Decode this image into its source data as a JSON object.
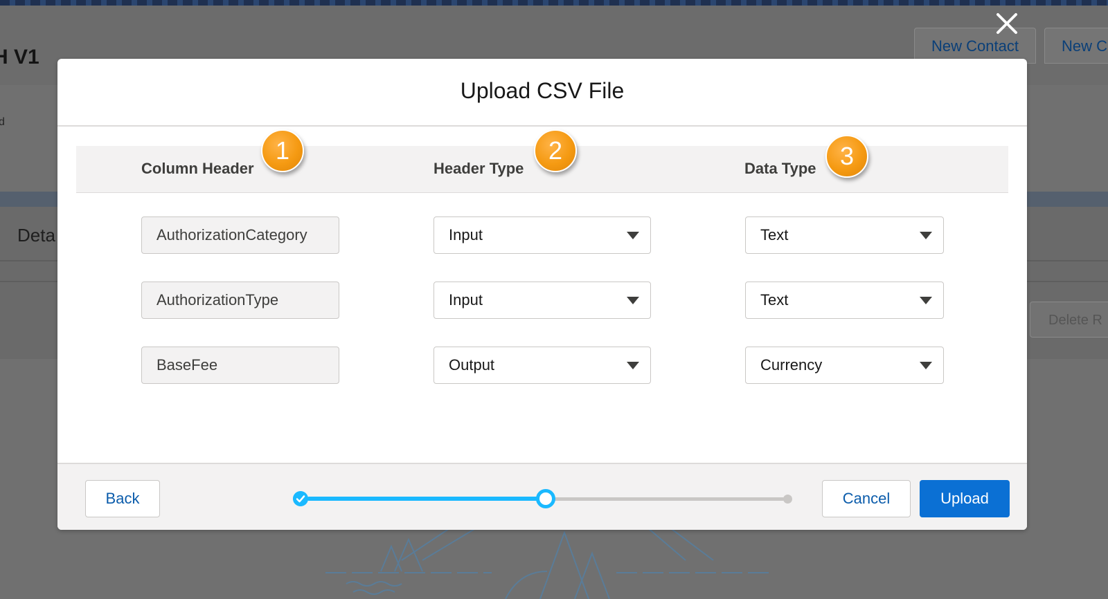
{
  "background": {
    "page_title": "H V1",
    "header_buttons": [
      "New Contact",
      "New C"
    ],
    "section_label": "Deta",
    "delete_button": "Delete R",
    "small_text": "d"
  },
  "modal": {
    "title": "Upload CSV File",
    "columns": {
      "column_header": "Column Header",
      "header_type": "Header Type",
      "data_type": "Data Type"
    },
    "annotations": [
      "1",
      "2",
      "3"
    ],
    "rows": [
      {
        "column_header": "AuthorizationCategory",
        "header_type": "Input",
        "data_type": "Text"
      },
      {
        "column_header": "AuthorizationType",
        "header_type": "Input",
        "data_type": "Text"
      },
      {
        "column_header": "BaseFee",
        "header_type": "Output",
        "data_type": "Currency"
      }
    ],
    "footer": {
      "back_label": "Back",
      "cancel_label": "Cancel",
      "upload_label": "Upload"
    },
    "progress": {
      "total_steps": 3,
      "current_step": 2,
      "fraction_complete": 0.5
    }
  },
  "icons": {
    "close": "close-icon",
    "step_done": "check-icon",
    "dropdown": "chevron-down-icon"
  },
  "colors": {
    "brand_blue": "#0b70d4",
    "progress_blue": "#1ab9ff",
    "annotation_orange": "#f59a12",
    "link_blue": "#0b5cab"
  }
}
